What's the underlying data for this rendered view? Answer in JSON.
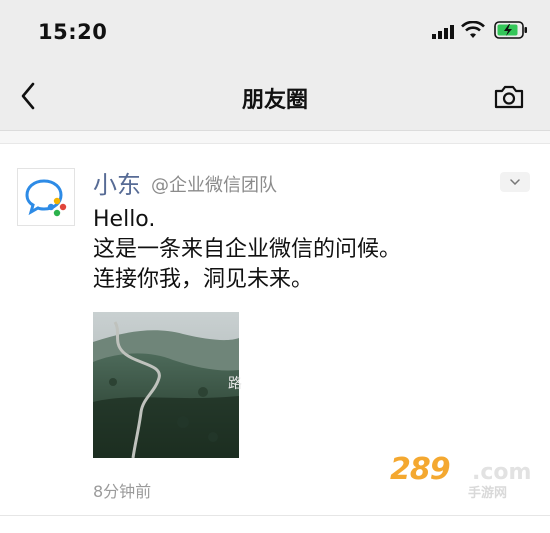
{
  "status_bar": {
    "time": "15:20"
  },
  "nav": {
    "title": "朋友圈"
  },
  "post": {
    "author": "小东",
    "org": "@企业微信团队",
    "lines": [
      "Hello.",
      "这是一条来自企业微信的问候。",
      "连接你我，洞见未来。"
    ],
    "image_caption": "路",
    "timestamp": "8分钟前"
  },
  "watermark": {
    "number": "289",
    "suffix": ".com",
    "sub": "手游网"
  },
  "colors": {
    "bar_bg": "#ededed",
    "name_blue": "#576b95",
    "battery_green": "#34c759",
    "watermark_orange": "#f4a830"
  }
}
